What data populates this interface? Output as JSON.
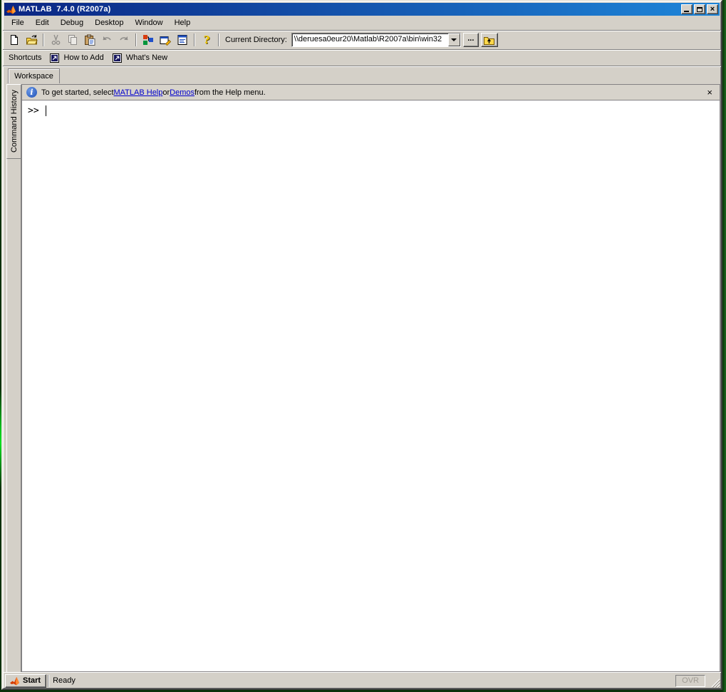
{
  "titlebar": {
    "title": "MATLAB  7.4.0 (R2007a)"
  },
  "menu": {
    "items": [
      "File",
      "Edit",
      "Debug",
      "Desktop",
      "Window",
      "Help"
    ]
  },
  "toolbar": {
    "current_directory_label": "Current Directory:",
    "current_directory_value": "\\\\deruesa0eur20\\Matlab\\R2007a\\bin\\win32",
    "browse_label": "...",
    "icons": [
      "new-file",
      "open-folder",
      "cut",
      "copy",
      "paste",
      "undo",
      "redo",
      "simulink",
      "guide",
      "profiler",
      "help",
      "browse",
      "up-folder"
    ]
  },
  "shortcuts": {
    "label": "Shortcuts",
    "how_to_add": "How to Add",
    "whats_new": "What's New"
  },
  "tabs": {
    "workspace": "Workspace",
    "command_history": "Command History"
  },
  "infobar": {
    "text_prefix": "To get started, select",
    "link_help": "MATLAB Help",
    "text_or": "or",
    "link_demos": "Demos",
    "text_suffix": "from the Help menu.",
    "close": "×"
  },
  "command_window": {
    "prompt": ">>"
  },
  "statusbar": {
    "start_label": "Start",
    "status_text": "Ready",
    "ovr_label": "OVR"
  },
  "colors": {
    "titlebar_gradient_start": "#0b2583",
    "titlebar_gradient_end": "#1e86d9",
    "window_chrome": "#d4d0c8",
    "desktop_green": "#0a300a",
    "link_blue": "#0000cc"
  }
}
